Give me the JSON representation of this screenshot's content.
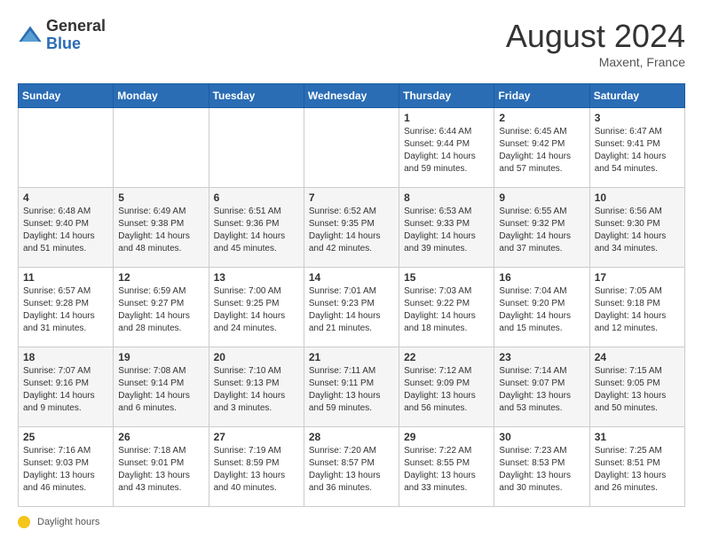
{
  "header": {
    "logo_general": "General",
    "logo_blue": "Blue",
    "month_year": "August 2024",
    "location": "Maxent, France"
  },
  "days_of_week": [
    "Sunday",
    "Monday",
    "Tuesday",
    "Wednesday",
    "Thursday",
    "Friday",
    "Saturday"
  ],
  "weeks": [
    [
      null,
      null,
      null,
      null,
      {
        "day": 1,
        "sunrise": "6:44 AM",
        "sunset": "9:44 PM",
        "daylight": "14 hours and 59 minutes."
      },
      {
        "day": 2,
        "sunrise": "6:45 AM",
        "sunset": "9:42 PM",
        "daylight": "14 hours and 57 minutes."
      },
      {
        "day": 3,
        "sunrise": "6:47 AM",
        "sunset": "9:41 PM",
        "daylight": "14 hours and 54 minutes."
      }
    ],
    [
      {
        "day": 4,
        "sunrise": "6:48 AM",
        "sunset": "9:40 PM",
        "daylight": "14 hours and 51 minutes."
      },
      {
        "day": 5,
        "sunrise": "6:49 AM",
        "sunset": "9:38 PM",
        "daylight": "14 hours and 48 minutes."
      },
      {
        "day": 6,
        "sunrise": "6:51 AM",
        "sunset": "9:36 PM",
        "daylight": "14 hours and 45 minutes."
      },
      {
        "day": 7,
        "sunrise": "6:52 AM",
        "sunset": "9:35 PM",
        "daylight": "14 hours and 42 minutes."
      },
      {
        "day": 8,
        "sunrise": "6:53 AM",
        "sunset": "9:33 PM",
        "daylight": "14 hours and 39 minutes."
      },
      {
        "day": 9,
        "sunrise": "6:55 AM",
        "sunset": "9:32 PM",
        "daylight": "14 hours and 37 minutes."
      },
      {
        "day": 10,
        "sunrise": "6:56 AM",
        "sunset": "9:30 PM",
        "daylight": "14 hours and 34 minutes."
      }
    ],
    [
      {
        "day": 11,
        "sunrise": "6:57 AM",
        "sunset": "9:28 PM",
        "daylight": "14 hours and 31 minutes."
      },
      {
        "day": 12,
        "sunrise": "6:59 AM",
        "sunset": "9:27 PM",
        "daylight": "14 hours and 28 minutes."
      },
      {
        "day": 13,
        "sunrise": "7:00 AM",
        "sunset": "9:25 PM",
        "daylight": "14 hours and 24 minutes."
      },
      {
        "day": 14,
        "sunrise": "7:01 AM",
        "sunset": "9:23 PM",
        "daylight": "14 hours and 21 minutes."
      },
      {
        "day": 15,
        "sunrise": "7:03 AM",
        "sunset": "9:22 PM",
        "daylight": "14 hours and 18 minutes."
      },
      {
        "day": 16,
        "sunrise": "7:04 AM",
        "sunset": "9:20 PM",
        "daylight": "14 hours and 15 minutes."
      },
      {
        "day": 17,
        "sunrise": "7:05 AM",
        "sunset": "9:18 PM",
        "daylight": "14 hours and 12 minutes."
      }
    ],
    [
      {
        "day": 18,
        "sunrise": "7:07 AM",
        "sunset": "9:16 PM",
        "daylight": "14 hours and 9 minutes."
      },
      {
        "day": 19,
        "sunrise": "7:08 AM",
        "sunset": "9:14 PM",
        "daylight": "14 hours and 6 minutes."
      },
      {
        "day": 20,
        "sunrise": "7:10 AM",
        "sunset": "9:13 PM",
        "daylight": "14 hours and 3 minutes."
      },
      {
        "day": 21,
        "sunrise": "7:11 AM",
        "sunset": "9:11 PM",
        "daylight": "13 hours and 59 minutes."
      },
      {
        "day": 22,
        "sunrise": "7:12 AM",
        "sunset": "9:09 PM",
        "daylight": "13 hours and 56 minutes."
      },
      {
        "day": 23,
        "sunrise": "7:14 AM",
        "sunset": "9:07 PM",
        "daylight": "13 hours and 53 minutes."
      },
      {
        "day": 24,
        "sunrise": "7:15 AM",
        "sunset": "9:05 PM",
        "daylight": "13 hours and 50 minutes."
      }
    ],
    [
      {
        "day": 25,
        "sunrise": "7:16 AM",
        "sunset": "9:03 PM",
        "daylight": "13 hours and 46 minutes."
      },
      {
        "day": 26,
        "sunrise": "7:18 AM",
        "sunset": "9:01 PM",
        "daylight": "13 hours and 43 minutes."
      },
      {
        "day": 27,
        "sunrise": "7:19 AM",
        "sunset": "8:59 PM",
        "daylight": "13 hours and 40 minutes."
      },
      {
        "day": 28,
        "sunrise": "7:20 AM",
        "sunset": "8:57 PM",
        "daylight": "13 hours and 36 minutes."
      },
      {
        "day": 29,
        "sunrise": "7:22 AM",
        "sunset": "8:55 PM",
        "daylight": "13 hours and 33 minutes."
      },
      {
        "day": 30,
        "sunrise": "7:23 AM",
        "sunset": "8:53 PM",
        "daylight": "13 hours and 30 minutes."
      },
      {
        "day": 31,
        "sunrise": "7:25 AM",
        "sunset": "8:51 PM",
        "daylight": "13 hours and 26 minutes."
      }
    ]
  ],
  "footer": {
    "daylight_label": "Daylight hours"
  }
}
